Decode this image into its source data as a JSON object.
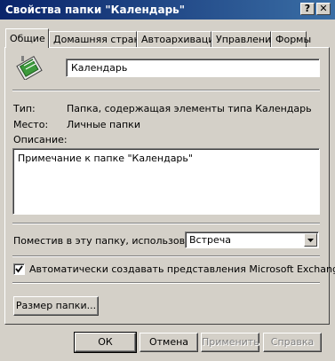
{
  "window": {
    "title": "Свойства папки \"Календарь\"",
    "help_glyph": "?",
    "close_glyph": "✕"
  },
  "tabs": [
    {
      "label": "Общие"
    },
    {
      "label": "Домашняя страница"
    },
    {
      "label": "Автоархивация"
    },
    {
      "label": "Управление"
    },
    {
      "label": "Формы"
    }
  ],
  "general": {
    "folder_name": "Календарь",
    "type_label": "Тип:",
    "type_value": "Папка, содержащая элементы типа Календарь",
    "location_label": "Место:",
    "location_value": "Личные папки",
    "description_label": "Описание:",
    "description_value": "Примечание к папке \"Календарь\"",
    "post_label": "Поместив в эту папку, использовать:",
    "post_value": "Встреча",
    "auto_views_label": "Автоматически создавать представления Microsoft Exchange",
    "auto_views_checked": true,
    "folder_size_button": "Размер папки..."
  },
  "footer": {
    "ok": "ОК",
    "cancel": "Отмена",
    "apply": "Применить",
    "help": "Справка"
  },
  "colors": {
    "titlebar_start": "#0a246a",
    "titlebar_end": "#3a6ea5",
    "face": "#d4d0c8"
  }
}
